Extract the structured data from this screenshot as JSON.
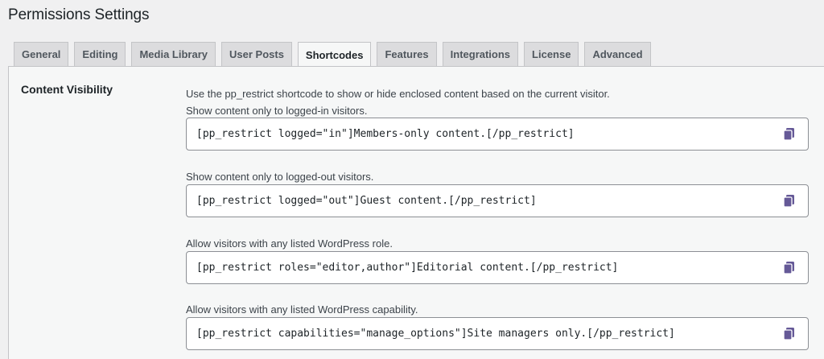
{
  "page": {
    "title": "Permissions Settings"
  },
  "tabs": [
    {
      "label": "General",
      "active": false
    },
    {
      "label": "Editing",
      "active": false
    },
    {
      "label": "Media Library",
      "active": false
    },
    {
      "label": "User Posts",
      "active": false
    },
    {
      "label": "Shortcodes",
      "active": true
    },
    {
      "label": "Features",
      "active": false
    },
    {
      "label": "Integrations",
      "active": false
    },
    {
      "label": "License",
      "active": false
    },
    {
      "label": "Advanced",
      "active": false
    }
  ],
  "section": {
    "title": "Content Visibility",
    "intro": "Use the pp_restrict shortcode to show or hide enclosed content based on the current visitor."
  },
  "examples": [
    {
      "description": "Show content only to logged-in visitors.",
      "code": "[pp_restrict logged=\"in\"]Members-only content.[/pp_restrict]"
    },
    {
      "description": "Show content only to logged-out visitors.",
      "code": "[pp_restrict logged=\"out\"]Guest content.[/pp_restrict]"
    },
    {
      "description": "Allow visitors with any listed WordPress role.",
      "code": "[pp_restrict roles=\"editor,author\"]Editorial content.[/pp_restrict]"
    },
    {
      "description": "Allow visitors with any listed WordPress capability.",
      "code": "[pp_restrict capabilities=\"manage_options\"]Site managers only.[/pp_restrict]"
    }
  ],
  "icons": {
    "copy": "copy-icon"
  },
  "colors": {
    "accent": "#655997",
    "tab_bg": "#dcdcde",
    "panel_bg": "#f6f7f7"
  }
}
